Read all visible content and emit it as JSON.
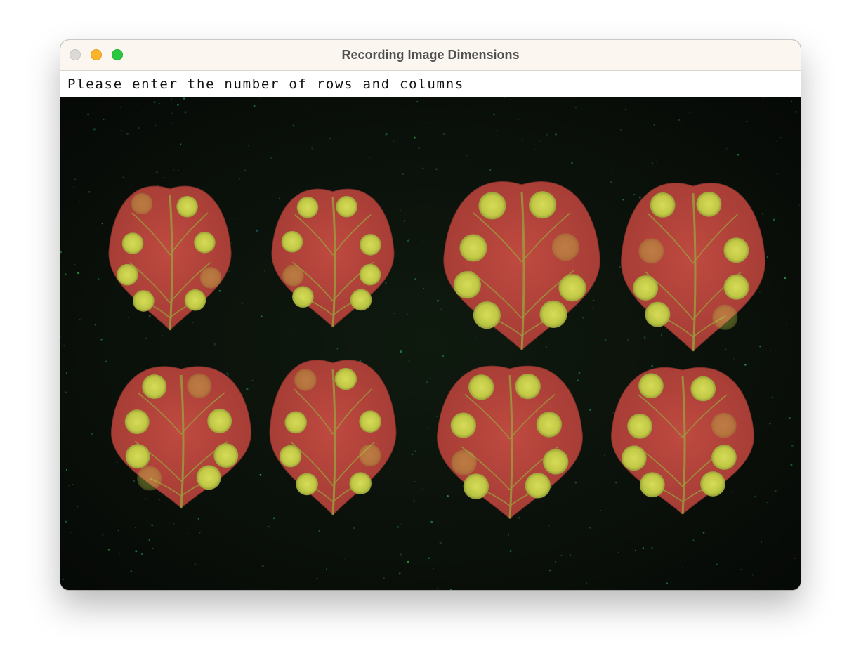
{
  "window": {
    "title": "Recording Image Dimensions",
    "controls": [
      "close",
      "minimize",
      "zoom"
    ]
  },
  "prompt": {
    "text": "Please enter the number of rows and columns"
  },
  "image": {
    "subject": "leaf-grid",
    "leaf_rows": 2,
    "leaf_columns": 4,
    "background_color": "#0a100a",
    "leaf_color": "#b5443c",
    "spot_color": "#c9d64a",
    "vein_color": "#9c9a3c"
  }
}
